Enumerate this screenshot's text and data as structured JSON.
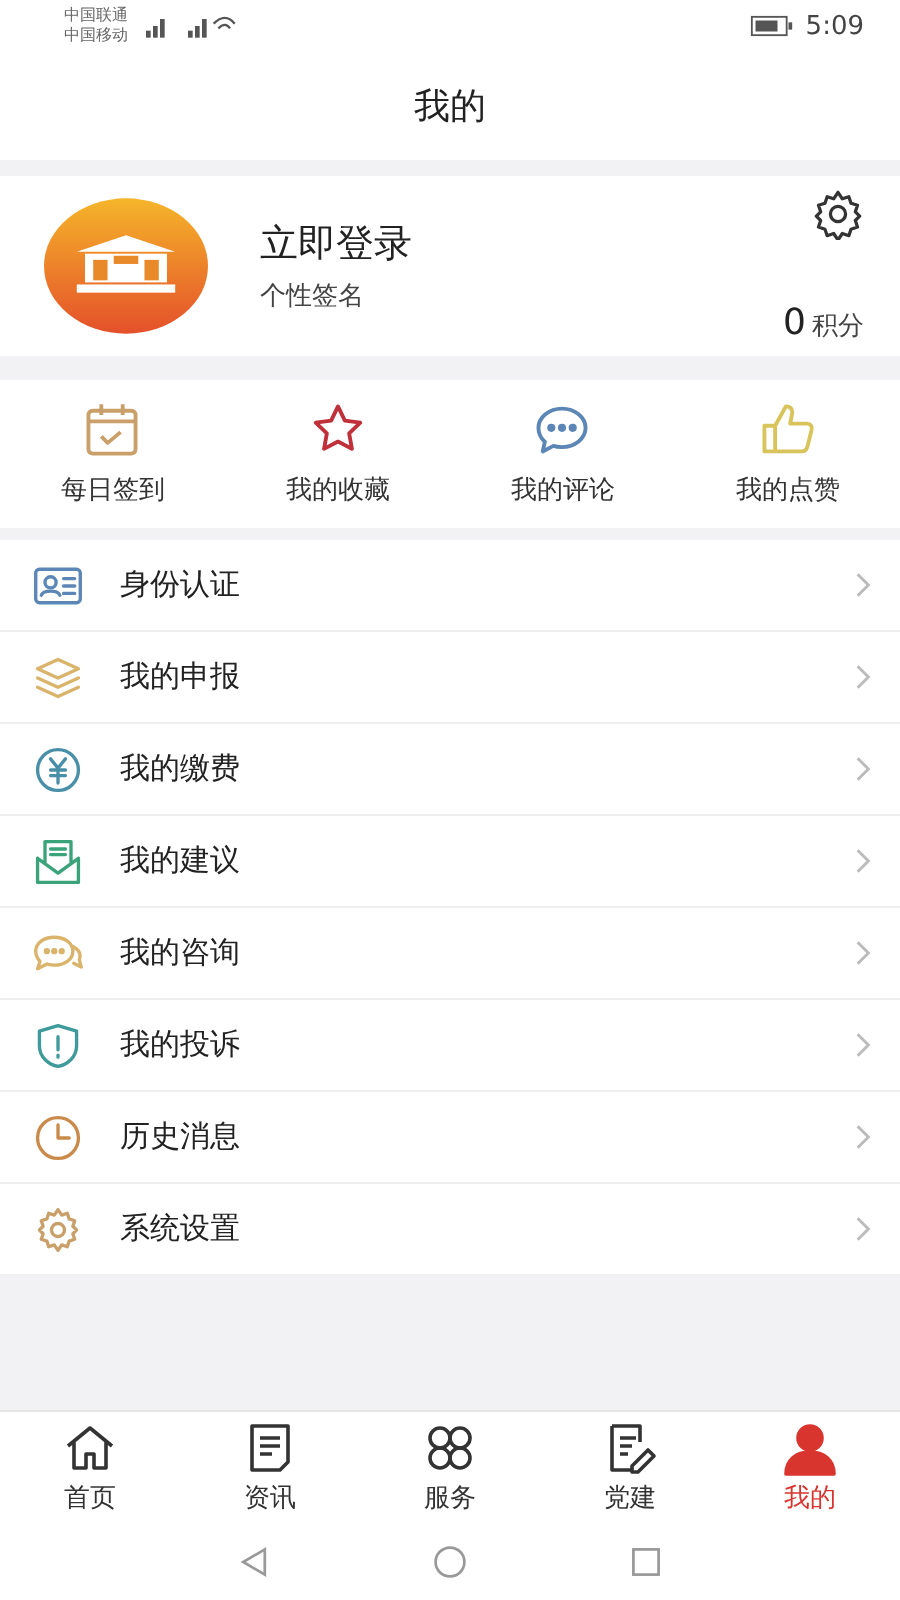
{
  "status_bar": {
    "carriers": [
      "中国联通",
      "中国移动"
    ],
    "time": "5:09"
  },
  "header": {
    "title": "我的"
  },
  "profile": {
    "name": "立即登录",
    "signature": "个性签名",
    "points": "0",
    "points_label": "积分"
  },
  "quick_actions": [
    {
      "kind": "calendar",
      "label": "每日签到",
      "color": "#c9a06a"
    },
    {
      "kind": "star",
      "label": "我的收藏",
      "color": "#c0303a"
    },
    {
      "kind": "comment",
      "label": "我的评论",
      "color": "#5b86b5"
    },
    {
      "kind": "thumb",
      "label": "我的点赞",
      "color": "#d8c45a"
    }
  ],
  "menu": [
    {
      "kind": "idcard",
      "label": "身份认证",
      "color": "#5b86b5"
    },
    {
      "kind": "layers",
      "label": "我的申报",
      "color": "#d9b46a"
    },
    {
      "kind": "yen",
      "label": "我的缴费",
      "color": "#4a8fa8"
    },
    {
      "kind": "mail",
      "label": "我的建议",
      "color": "#3aa37a"
    },
    {
      "kind": "chat",
      "label": "我的咨询",
      "color": "#d9b46a"
    },
    {
      "kind": "shield",
      "label": "我的投诉",
      "color": "#3f9b9b"
    },
    {
      "kind": "clock",
      "label": "历史消息",
      "color": "#c98a4a"
    },
    {
      "kind": "gear",
      "label": "系统设置",
      "color": "#c9a06a"
    }
  ],
  "tab_bar": [
    {
      "kind": "home",
      "label": "首页",
      "selected": false
    },
    {
      "kind": "news",
      "label": "资讯",
      "selected": false
    },
    {
      "kind": "grid",
      "label": "服务",
      "selected": false
    },
    {
      "kind": "party",
      "label": "党建",
      "selected": false
    },
    {
      "kind": "user",
      "label": "我的",
      "selected": true
    }
  ]
}
